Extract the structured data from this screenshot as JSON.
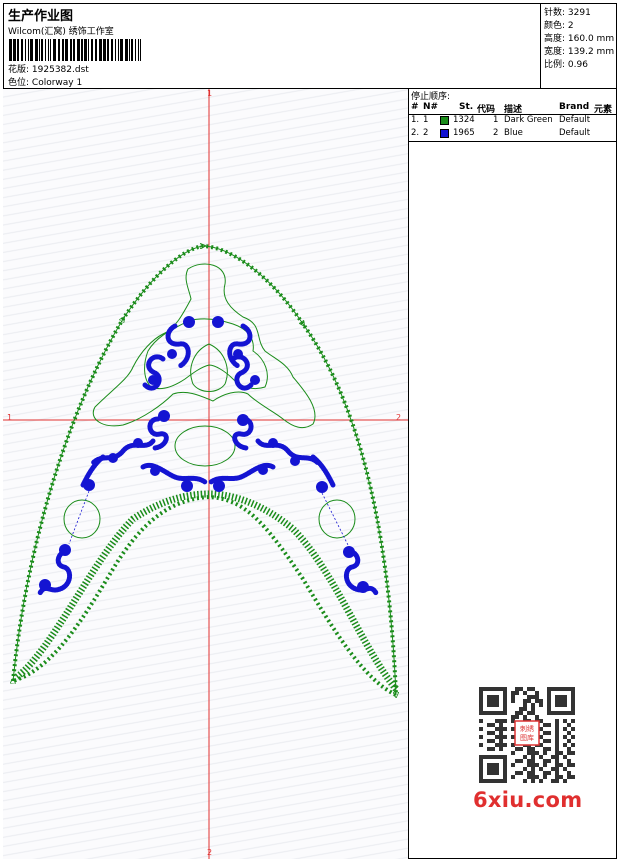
{
  "header": {
    "title": "生产作业图",
    "company": "Wilcom(汇窝) 绣饰工作室",
    "design_label": "花版:",
    "design_value": "1925382.dst",
    "colorway_label": "色位:",
    "colorway_value": "Colorway 1"
  },
  "stats": [
    {
      "label": "针数:",
      "value": "3291"
    },
    {
      "label": "颜色:",
      "value": "2"
    },
    {
      "label": "高度:",
      "value": "160.0 mm"
    },
    {
      "label": "宽度:",
      "value": "139.2 mm"
    },
    {
      "label": "比例:",
      "value": "0.96"
    }
  ],
  "stop_sequence": {
    "title": "停止顺序:",
    "columns": [
      "#",
      "N#",
      "St.",
      "代码",
      "描述",
      "Brand",
      "元素"
    ],
    "rows": [
      {
        "idx": "1.",
        "n": "1",
        "color": "#1a8c1a",
        "stitches": "1324",
        "code": "1",
        "desc": "Dark Green",
        "brand": "Default"
      },
      {
        "idx": "2.",
        "n": "2",
        "color": "#1414d2",
        "stitches": "1965",
        "code": "2",
        "desc": "Blue",
        "brand": "Default"
      }
    ]
  },
  "axes": {
    "top": "1",
    "bottom": "2",
    "left": "1",
    "right": "2",
    "color": "#e03030"
  },
  "colors": {
    "green": "#1a8c1a",
    "blue": "#1414d2"
  },
  "watermark": "6xiu.com",
  "qr_badge": "刺绣图库"
}
